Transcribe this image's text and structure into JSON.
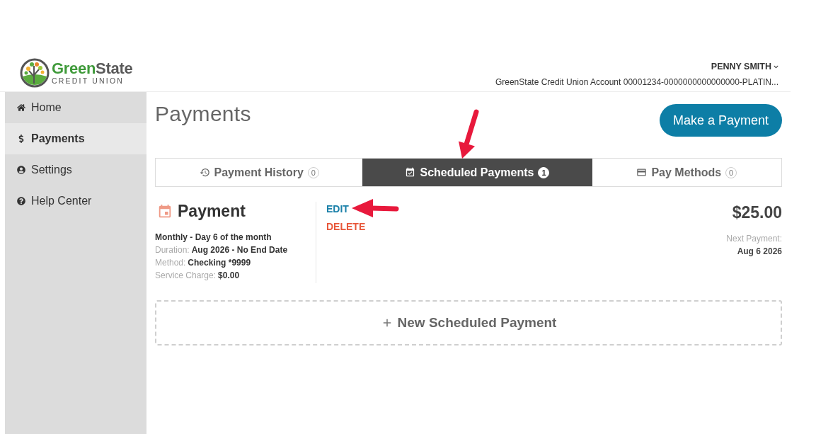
{
  "header": {
    "logo": {
      "wordmark": [
        "Green",
        "State"
      ],
      "subtitle": "CREDIT UNION"
    },
    "user": {
      "name": "PENNY SMITH",
      "account": "GreenState Credit Union Account 00001234-0000000000000000-PLATIN..."
    }
  },
  "sidebar": {
    "items": [
      {
        "label": "Home",
        "selected": false
      },
      {
        "label": "Payments",
        "selected": true
      },
      {
        "label": "Settings",
        "selected": false
      },
      {
        "label": "Help Center",
        "selected": false
      }
    ]
  },
  "page": {
    "title": "Payments",
    "primary_button": "Make a Payment"
  },
  "tabs": [
    {
      "label": "Payment History",
      "count": "0",
      "selected": false
    },
    {
      "label": "Scheduled Payments",
      "count": "1",
      "selected": true
    },
    {
      "label": "Pay Methods",
      "count": "0",
      "selected": false
    }
  ],
  "scheduled_payment": {
    "title": "Payment",
    "schedule": "Monthly - Day 6 of the month",
    "details": [
      {
        "label": "Duration:",
        "value": "Aug 2026 - No End Date"
      },
      {
        "label": "Method:",
        "value": "Checking *9999"
      },
      {
        "label": "Service Charge:",
        "value": "$0.00"
      }
    ],
    "actions": [
      {
        "label": "EDIT",
        "kind": "edit"
      },
      {
        "label": "DELETE",
        "kind": "delete"
      }
    ],
    "amount": "$25.00",
    "next_payment": {
      "label": "Next Payment:",
      "date": "Aug 6 2026"
    }
  },
  "new_button": {
    "label": "New Scheduled Payment"
  }
}
